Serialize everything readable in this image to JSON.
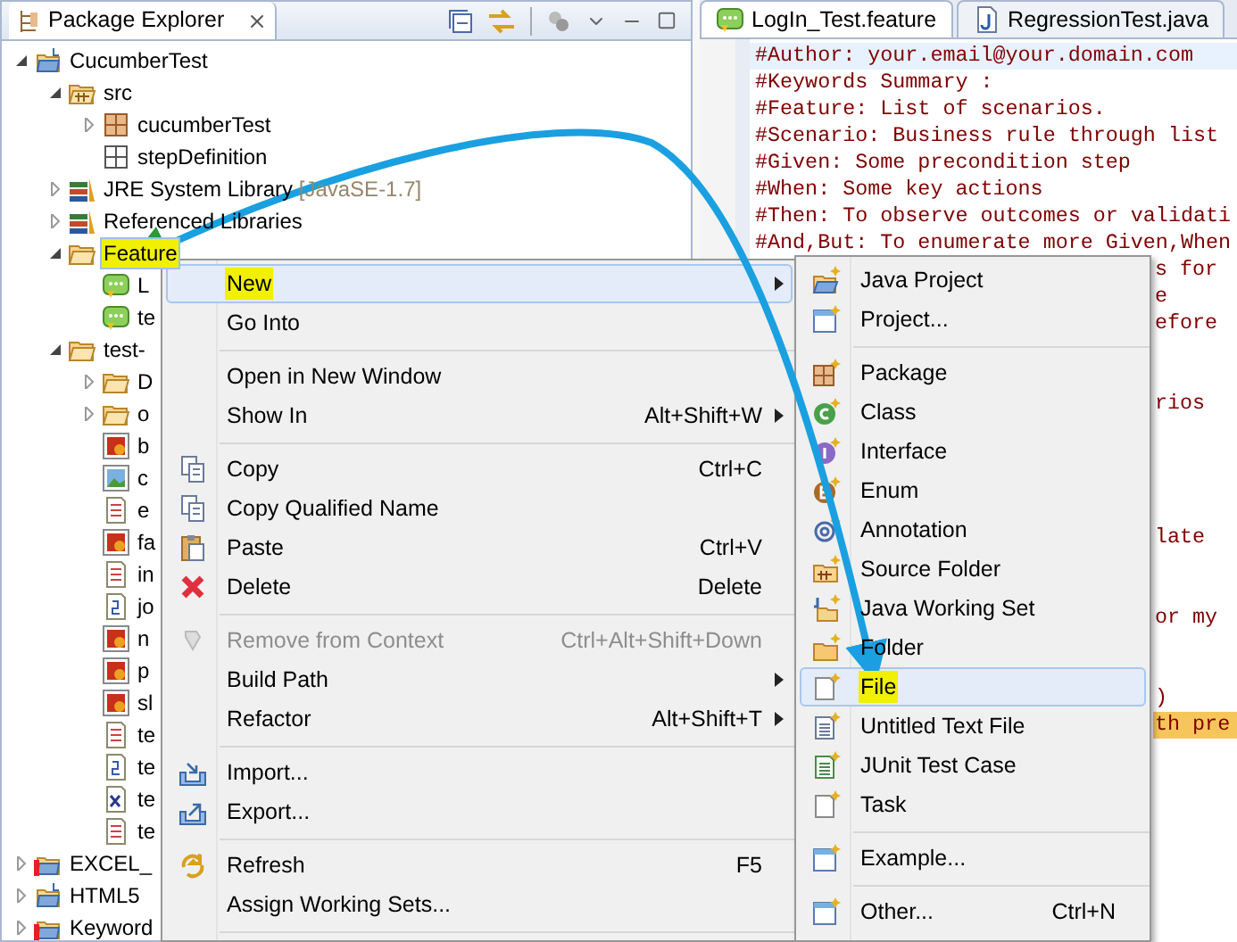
{
  "explorer": {
    "title": "Package Explorer",
    "tree": [
      {
        "label": "CucumberTest",
        "kind": "project",
        "expanded": true,
        "selected": false,
        "children": [
          {
            "label": "src",
            "kind": "source-folder",
            "expanded": true,
            "selected": false,
            "children": [
              {
                "label": "cucumberTest",
                "kind": "package",
                "expanded": false,
                "selected": false
              },
              {
                "label": "stepDefinition",
                "kind": "package-empty",
                "selected": false
              }
            ]
          },
          {
            "label": "JRE System Library",
            "decoration": "[JavaSE-1.7]",
            "kind": "library",
            "expanded": false,
            "selected": false
          },
          {
            "label": "Referenced Libraries",
            "kind": "library",
            "expanded": false,
            "selected": false
          },
          {
            "label": "Feature",
            "kind": "folder",
            "expanded": true,
            "selected": true,
            "marked": true,
            "children": [
              {
                "label": "L",
                "kind": "feature",
                "selected": false
              },
              {
                "label": "te",
                "kind": "feature",
                "selected": false
              }
            ]
          },
          {
            "label": "test-",
            "kind": "folder",
            "expanded": true,
            "selected": false,
            "children": [
              {
                "label": "D",
                "kind": "folder",
                "expanded": false,
                "selected": false
              },
              {
                "label": "o",
                "kind": "folder",
                "expanded": false,
                "selected": false
              },
              {
                "label": "b",
                "kind": "image",
                "selected": false
              },
              {
                "label": "c",
                "kind": "picture-file",
                "selected": false
              },
              {
                "label": "e",
                "kind": "text",
                "selected": false
              },
              {
                "label": "fa",
                "kind": "image",
                "selected": false
              },
              {
                "label": "in",
                "kind": "text",
                "selected": false
              },
              {
                "label": "jo",
                "kind": "script",
                "selected": false
              },
              {
                "label": "n",
                "kind": "image",
                "selected": false
              },
              {
                "label": "p",
                "kind": "image",
                "selected": false
              },
              {
                "label": "sl",
                "kind": "image",
                "selected": false
              },
              {
                "label": "te",
                "kind": "text",
                "selected": false
              },
              {
                "label": "te",
                "kind": "script",
                "selected": false
              },
              {
                "label": "te",
                "kind": "xml",
                "selected": false
              },
              {
                "label": "te",
                "kind": "text",
                "selected": false
              }
            ]
          }
        ]
      },
      {
        "label": "EXCEL_",
        "kind": "project-error",
        "expanded": false,
        "selected": false
      },
      {
        "label": "HTML5",
        "kind": "project",
        "expanded": false,
        "selected": false
      },
      {
        "label": "Keyword",
        "kind": "project-error",
        "expanded": false,
        "selected": false
      }
    ]
  },
  "editor": {
    "tabs": [
      {
        "label": "LogIn_Test.feature",
        "kind": "feature",
        "selected": true
      },
      {
        "label": "RegressionTest.java",
        "kind": "java",
        "selected": false
      }
    ],
    "lines": [
      {
        "kind": "current",
        "text": "#Author: your.email@your.domain.com"
      },
      {
        "kind": "full",
        "text": "#Keywords Summary :"
      },
      {
        "kind": "full",
        "text": "#Feature: List of scenarios."
      },
      {
        "kind": "full",
        "text": "#Scenario: Business rule through list"
      },
      {
        "kind": "full",
        "text": "#Given: Some precondition step"
      },
      {
        "kind": "full",
        "text": "#When: Some key actions"
      },
      {
        "kind": "full",
        "text": "#Then: To observe outcomes or validati"
      },
      {
        "kind": "full",
        "text": "#And,But: To enumerate more Given,When"
      },
      {
        "kind": "fragment",
        "text": "s for"
      },
      {
        "kind": "fragment",
        "text": "e"
      },
      {
        "kind": "fragment",
        "text": "efore"
      },
      {
        "kind": "blank"
      },
      {
        "kind": "blank"
      },
      {
        "kind": "fragment",
        "text": "rios"
      },
      {
        "kind": "blank"
      },
      {
        "kind": "blank"
      },
      {
        "kind": "blank"
      },
      {
        "kind": "blank"
      },
      {
        "kind": "fragment",
        "text": "late"
      },
      {
        "kind": "blank"
      },
      {
        "kind": "blank"
      },
      {
        "kind": "fragment",
        "text": "or my"
      },
      {
        "kind": "blank"
      },
      {
        "kind": "blank"
      },
      {
        "kind": "fragment",
        "text": ")"
      },
      {
        "kind": "occurrence",
        "text": "th pre"
      }
    ]
  },
  "context_menu": {
    "items": [
      {
        "kind": "item",
        "label": "New",
        "submenu": true,
        "selected": true,
        "marked": true,
        "disabled": false
      },
      {
        "kind": "item",
        "label": "Go Into",
        "submenu": false,
        "selected": false,
        "disabled": false
      },
      {
        "kind": "separator"
      },
      {
        "kind": "item",
        "label": "Open in New Window",
        "submenu": false,
        "selected": false,
        "disabled": false
      },
      {
        "kind": "item",
        "label": "Show In",
        "shortcut": "Alt+Shift+W",
        "submenu": true,
        "selected": false,
        "disabled": false
      },
      {
        "kind": "separator"
      },
      {
        "kind": "item",
        "label": "Copy",
        "shortcut": "Ctrl+C",
        "submenu": false,
        "selected": false,
        "disabled": false
      },
      {
        "kind": "item",
        "label": "Copy Qualified Name",
        "submenu": false,
        "selected": false,
        "disabled": false
      },
      {
        "kind": "item",
        "label": "Paste",
        "shortcut": "Ctrl+V",
        "submenu": false,
        "selected": false,
        "disabled": false
      },
      {
        "kind": "item",
        "label": "Delete",
        "shortcut": "Delete",
        "submenu": false,
        "selected": false,
        "disabled": false
      },
      {
        "kind": "separator"
      },
      {
        "kind": "item",
        "label": "Remove from Context",
        "shortcut": "Ctrl+Alt+Shift+Down",
        "submenu": false,
        "selected": false,
        "disabled": true
      },
      {
        "kind": "item",
        "label": "Build Path",
        "submenu": true,
        "selected": false,
        "disabled": false
      },
      {
        "kind": "item",
        "label": "Refactor",
        "shortcut": "Alt+Shift+T",
        "submenu": true,
        "selected": false,
        "disabled": false
      },
      {
        "kind": "separator"
      },
      {
        "kind": "item",
        "label": "Import...",
        "submenu": false,
        "selected": false,
        "disabled": false
      },
      {
        "kind": "item",
        "label": "Export...",
        "submenu": false,
        "selected": false,
        "disabled": false
      },
      {
        "kind": "separator"
      },
      {
        "kind": "item",
        "label": "Refresh",
        "shortcut": "F5",
        "submenu": false,
        "selected": false,
        "disabled": false
      },
      {
        "kind": "item",
        "label": "Assign Working Sets...",
        "submenu": false,
        "selected": false,
        "disabled": false
      },
      {
        "kind": "separator"
      }
    ]
  },
  "submenu": {
    "items": [
      {
        "kind": "item",
        "label": "Java Project",
        "selected": false
      },
      {
        "kind": "item",
        "label": "Project...",
        "selected": false
      },
      {
        "kind": "separator"
      },
      {
        "kind": "item",
        "label": "Package",
        "selected": false
      },
      {
        "kind": "item",
        "label": "Class",
        "selected": false
      },
      {
        "kind": "item",
        "label": "Interface",
        "selected": false
      },
      {
        "kind": "item",
        "label": "Enum",
        "selected": false
      },
      {
        "kind": "item",
        "label": "Annotation",
        "selected": false
      },
      {
        "kind": "item",
        "label": "Source Folder",
        "selected": false
      },
      {
        "kind": "item",
        "label": "Java Working Set",
        "selected": false
      },
      {
        "kind": "item",
        "label": "Folder",
        "selected": false
      },
      {
        "kind": "item",
        "label": "File",
        "selected": true,
        "marked": true
      },
      {
        "kind": "item",
        "label": "Untitled Text File",
        "selected": false
      },
      {
        "kind": "item",
        "label": "JUnit Test Case",
        "selected": false
      },
      {
        "kind": "item",
        "label": "Task",
        "selected": false
      },
      {
        "kind": "separator"
      },
      {
        "kind": "item",
        "label": "Example...",
        "selected": false
      },
      {
        "kind": "separator"
      },
      {
        "kind": "item",
        "label": "Other...",
        "shortcut": "Ctrl+N",
        "selected": false
      }
    ]
  }
}
